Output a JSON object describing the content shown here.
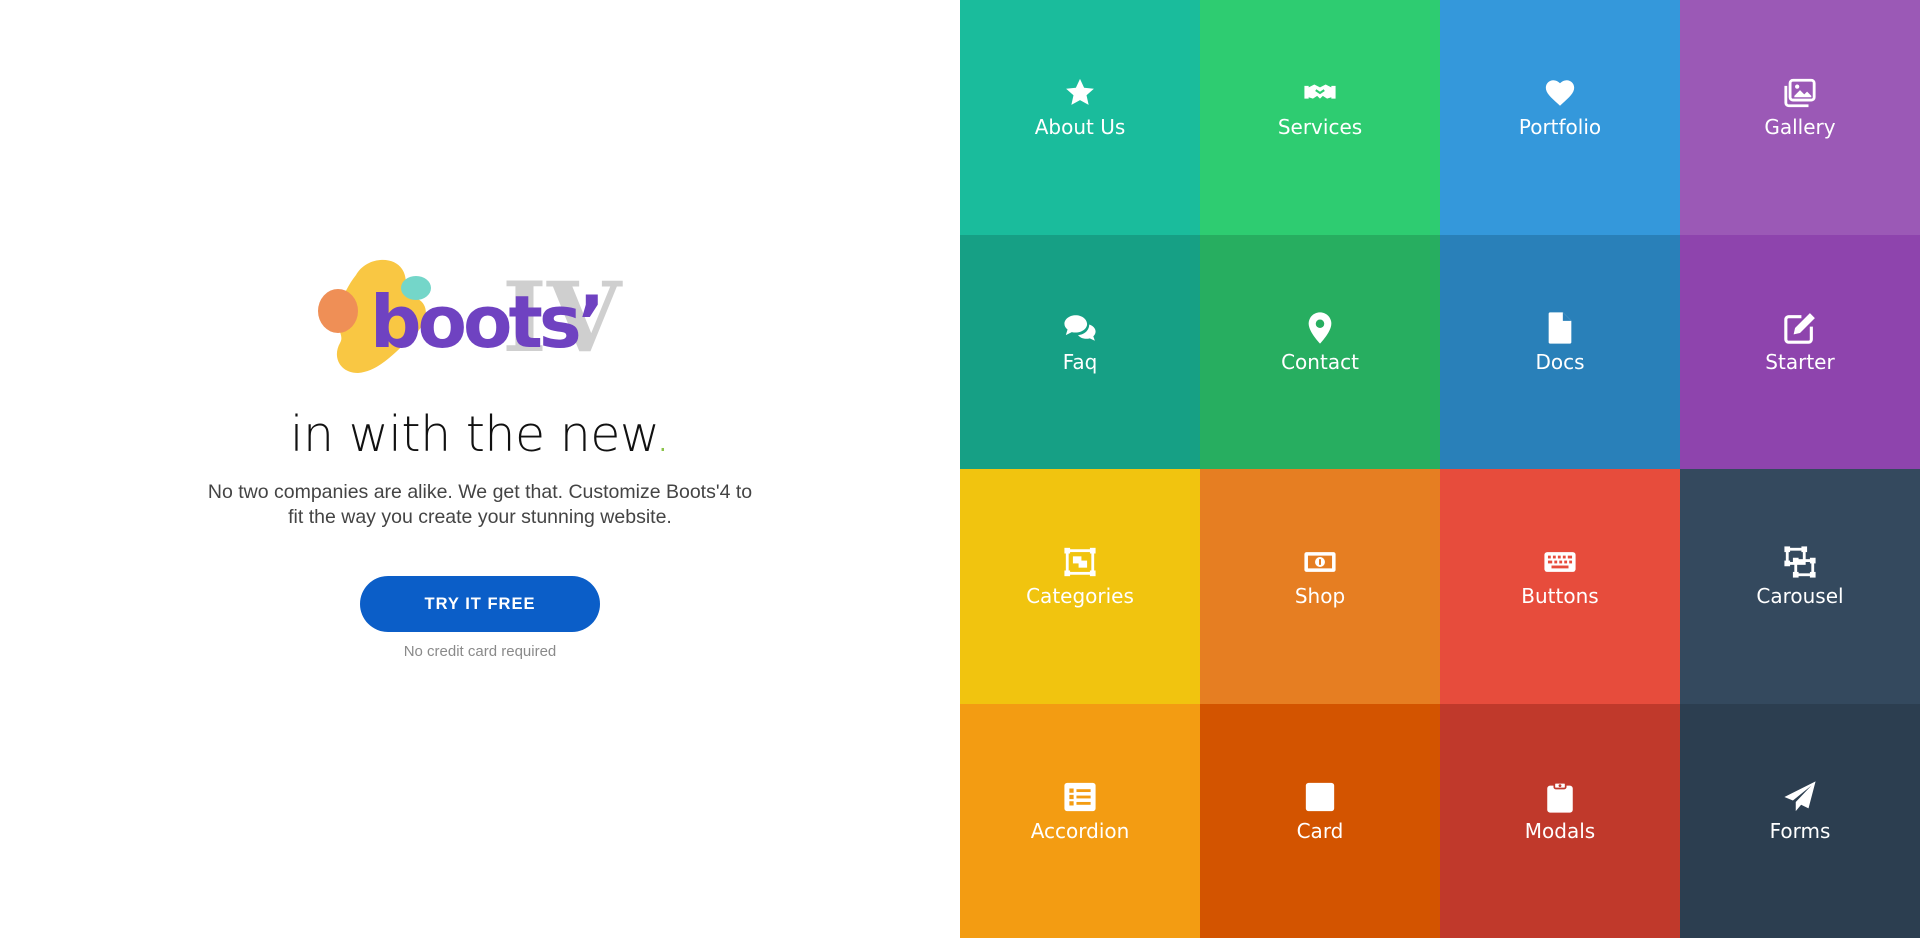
{
  "hero": {
    "logo_alt": "boots'IV",
    "headline": "in with the new",
    "headline_dot": ".",
    "description": "No two companies are alike. We get that. Customize Boots'4 to fit the way you create your stunning website.",
    "cta_label": "TRY IT FREE",
    "note": "No credit card required",
    "colors": {
      "cta": "#0b5ec8",
      "dot": "#8bc34a",
      "logo_purple": "#6f42c1"
    }
  },
  "tiles": [
    {
      "label": "About Us",
      "icon": "star-icon",
      "color": "#1abc9c"
    },
    {
      "label": "Services",
      "icon": "handshake-icon",
      "color": "#2ecc71"
    },
    {
      "label": "Portfolio",
      "icon": "heart-icon",
      "color": "#3498db"
    },
    {
      "label": "Gallery",
      "icon": "images-icon",
      "color": "#9b59b6"
    },
    {
      "label": "Faq",
      "icon": "comments-icon",
      "color": "#16a085"
    },
    {
      "label": "Contact",
      "icon": "map-marker-icon",
      "color": "#27ae60"
    },
    {
      "label": "Docs",
      "icon": "file-icon",
      "color": "#2980b9"
    },
    {
      "label": "Starter",
      "icon": "edit-icon",
      "color": "#8e44ad"
    },
    {
      "label": "Categories",
      "icon": "object-group-icon",
      "color": "#f1c40f"
    },
    {
      "label": "Shop",
      "icon": "money-bill-icon",
      "color": "#e67e22"
    },
    {
      "label": "Buttons",
      "icon": "keyboard-icon",
      "color": "#e74c3c"
    },
    {
      "label": "Carousel",
      "icon": "object-ungroup-icon",
      "color": "#34495e"
    },
    {
      "label": "Accordion",
      "icon": "list-alt-icon",
      "color": "#f39c12"
    },
    {
      "label": "Card",
      "icon": "square-icon",
      "color": "#d35400"
    },
    {
      "label": "Modals",
      "icon": "clipboard-icon",
      "color": "#c0392b"
    },
    {
      "label": "Forms",
      "icon": "paper-plane-icon",
      "color": "#2c3e50"
    }
  ]
}
